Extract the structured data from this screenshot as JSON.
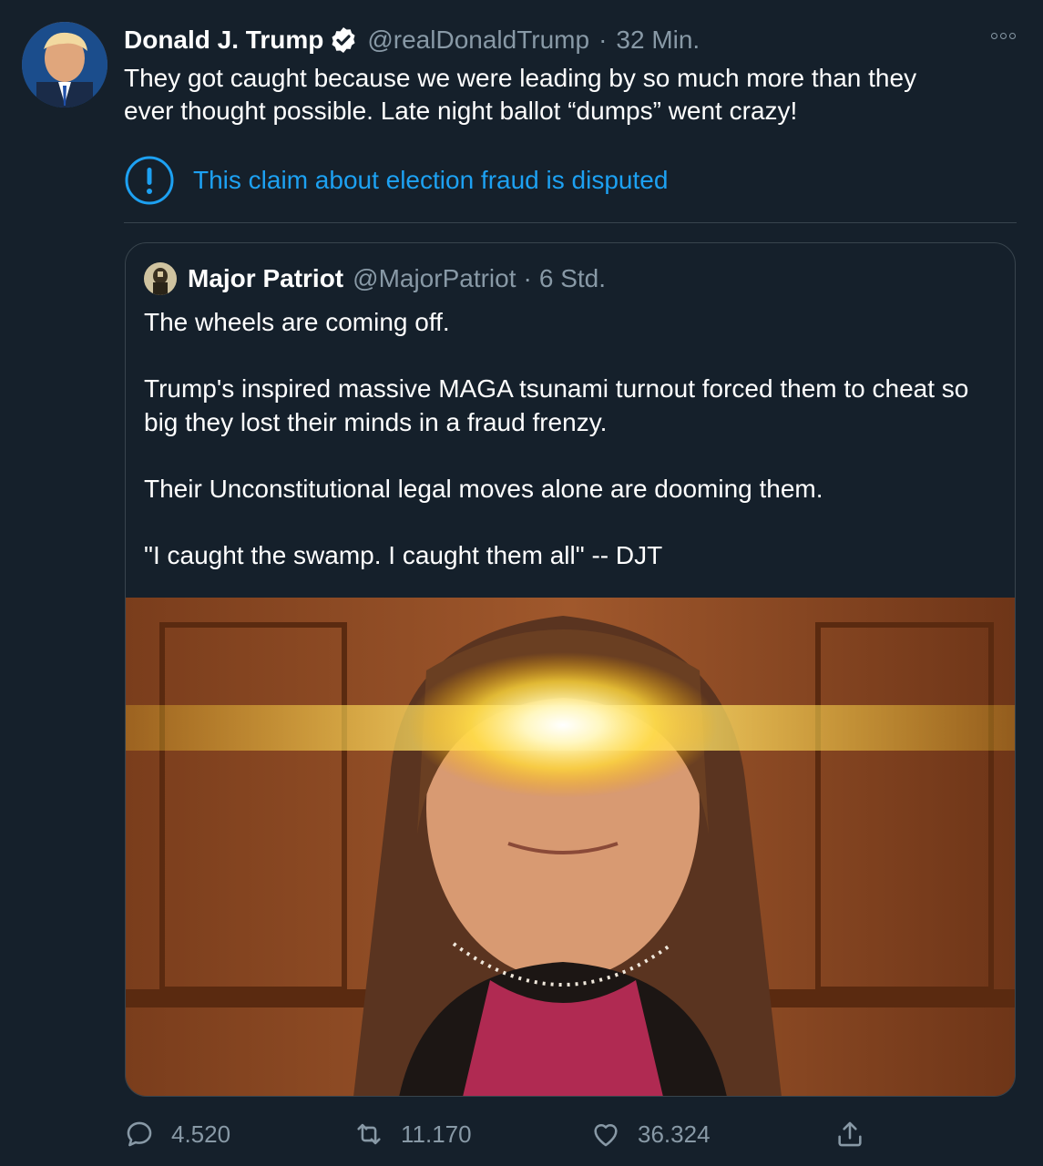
{
  "tweet": {
    "author": {
      "name": "Donald J. Trump",
      "handle": "@realDonaldTrump",
      "avatar_icon": "avatar-photo",
      "verified_icon": "verified-badge-icon"
    },
    "separator": "·",
    "time": "32 Min.",
    "text_line1": "They got caught because we were leading by so much more than they",
    "text_line2": "ever thought possible. Late night ballot “dumps” went crazy!",
    "notice": {
      "icon": "exclamation-circle-icon",
      "text": "This claim about election fraud is disputed",
      "color": "#1da1f2"
    }
  },
  "quoted": {
    "author": {
      "name": "Major Patriot",
      "handle": "@MajorPatriot"
    },
    "separator": "·",
    "time": "6 Std.",
    "paragraphs": [
      "The wheels are coming off.",
      "Trump's inspired massive MAGA tsunami turnout forced them to cheat so big they lost their minds in a fraud frenzy.",
      "Their Unconstitutional legal moves alone are dooming them.",
      "\"I caught the swamp. I caught them all\" -- DJT"
    ],
    "media_icon": "photo-laser-eyes-image"
  },
  "actions": {
    "reply": {
      "icon": "reply-icon",
      "count": "4.520"
    },
    "retweet": {
      "icon": "retweet-icon",
      "count": "11.170"
    },
    "like": {
      "icon": "heart-icon",
      "count": "36.324"
    },
    "share": {
      "icon": "share-icon"
    }
  },
  "colors": {
    "background": "#15202b",
    "secondary_text": "#8899a6",
    "border": "#38444d",
    "accent": "#1da1f2"
  }
}
